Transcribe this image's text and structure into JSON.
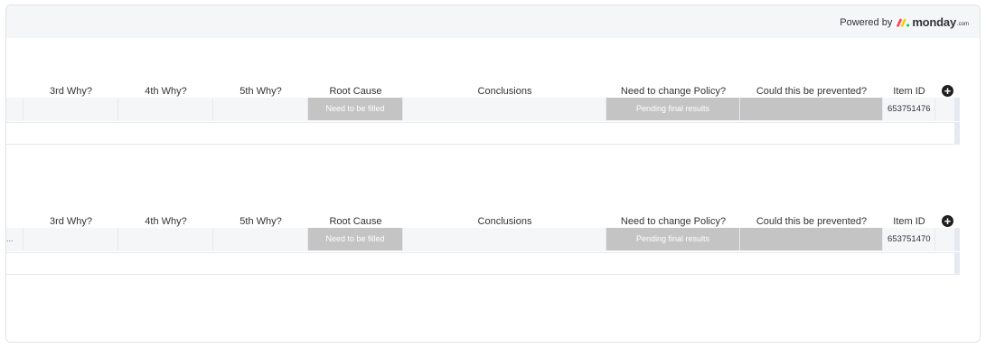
{
  "branding": {
    "powered_by": "Powered by",
    "logo_word": "monday",
    "logo_suffix": ".com"
  },
  "columns": [
    "3rd Why?",
    "4th Why?",
    "5th Why?",
    "Root Cause",
    "Conclusions",
    "Need to change Policy?",
    "Could this be prevented?",
    "Item ID"
  ],
  "groups": [
    {
      "lead_text": "",
      "root_cause": "Need to be filled",
      "policy": "Pending final results",
      "item_id": "653751476"
    },
    {
      "lead_text": "...",
      "root_cause": "Need to be filled",
      "policy": "Pending final results",
      "item_id": "653751470"
    }
  ],
  "colors": {
    "status_gray": "#c4c4c4",
    "row_bg": "#f5f6f8",
    "logo_red": "#ff3d57",
    "logo_yellow": "#ffcb00",
    "logo_green": "#00d647"
  },
  "add_column_icon": "+"
}
